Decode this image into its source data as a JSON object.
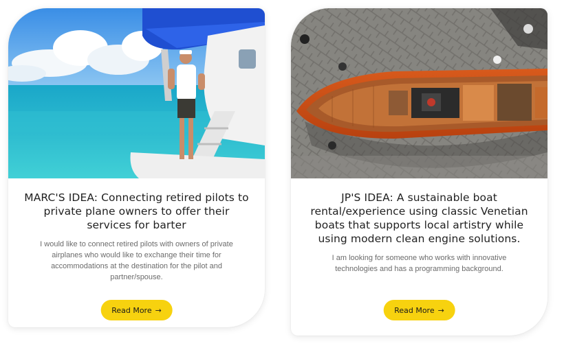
{
  "cards": [
    {
      "title": "MARC'S IDEA: Connecting retired pilots to private plane owners to offer their services for barter",
      "description": "I would like to connect retired pilots with owners of private airplanes who would like to exchange their time for accommodations at the destination for the pilot and partner/spouse.",
      "button_label": "Read More",
      "image": "seaplane-pilot-photo"
    },
    {
      "title": "JP'S IDEA: A sustainable boat rental/experience using classic Venetian boats that supports local artistry while using modern clean engine solutions.",
      "description": "I am looking for someone who works with innovative technologies and has a programming background.",
      "button_label": "Read More",
      "image": "venetian-boat-aerial-photo"
    }
  ],
  "icons": {
    "button_arrow": "arrow-right-icon"
  },
  "colors": {
    "button": "#f7d20f",
    "title": "#1f1f1f",
    "description": "#6b6b6b"
  }
}
